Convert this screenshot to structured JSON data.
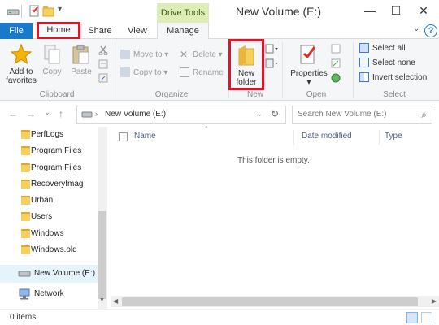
{
  "window": {
    "title": "New Volume (E:)",
    "context_tab": "Drive Tools",
    "minimize": "—",
    "maximize": "☐",
    "close": "✕"
  },
  "tabs": {
    "file": "File",
    "home": "Home",
    "share": "Share",
    "view": "View",
    "manage": "Manage"
  },
  "ribbon": {
    "clipboard": {
      "label": "Clipboard",
      "add_to_favorites": "Add to\nfavorites",
      "copy": "Copy",
      "paste": "Paste"
    },
    "organize": {
      "label": "Organize",
      "move_to": "Move to",
      "copy_to": "Copy to",
      "delete": "Delete",
      "rename": "Rename"
    },
    "new": {
      "label": "New",
      "new_folder": "New\nfolder"
    },
    "open": {
      "label": "Open",
      "properties": "Properties"
    },
    "select": {
      "label": "Select",
      "select_all": "Select all",
      "select_none": "Select none",
      "invert_selection": "Invert selection"
    }
  },
  "address": {
    "path": "New Volume (E:)",
    "search_placeholder": "Search New Volume (E:)"
  },
  "nav": {
    "folders": [
      "PerfLogs",
      "Program Files",
      "Program Files",
      "RecoveryImag",
      "Urban",
      "Users",
      "Windows",
      "Windows.old"
    ],
    "drive": "New Volume (E:)",
    "network": "Network"
  },
  "columns": {
    "name": "Name",
    "date_modified": "Date modified",
    "type": "Type"
  },
  "content": {
    "empty_message": "This folder is empty."
  },
  "status": {
    "items": "0 items"
  },
  "colors": {
    "accent": "#1979ca",
    "highlight": "#e81123",
    "folder": "#f7cf5d",
    "context_tab": "#dcedb8"
  }
}
